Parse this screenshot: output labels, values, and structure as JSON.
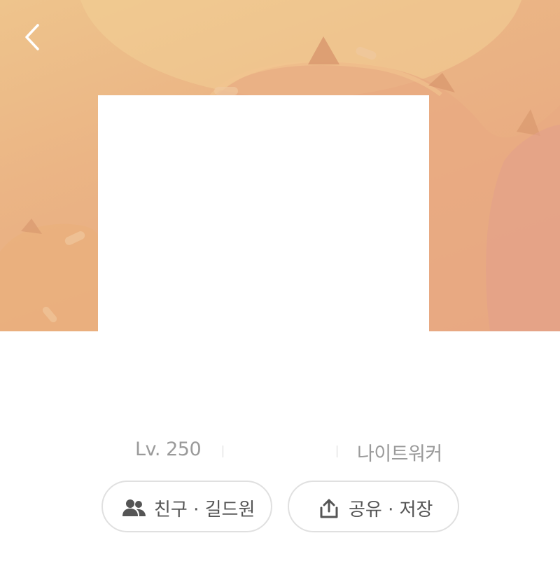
{
  "header": {
    "back_icon": "chevron-left-icon"
  },
  "profile": {
    "level": "Lv. 250",
    "job": "나이트워커"
  },
  "actions": {
    "friends_guild": {
      "label": "친구 · 길드원",
      "icon": "people-icon"
    },
    "share_save": {
      "label": "공유 · 저장",
      "icon": "share-icon"
    }
  },
  "colors": {
    "banner_top": "#eec48c",
    "banner_bottom": "#e6a585",
    "text_muted": "#9a9a9a",
    "button_text": "#555555",
    "button_border": "#e0e0e0"
  }
}
